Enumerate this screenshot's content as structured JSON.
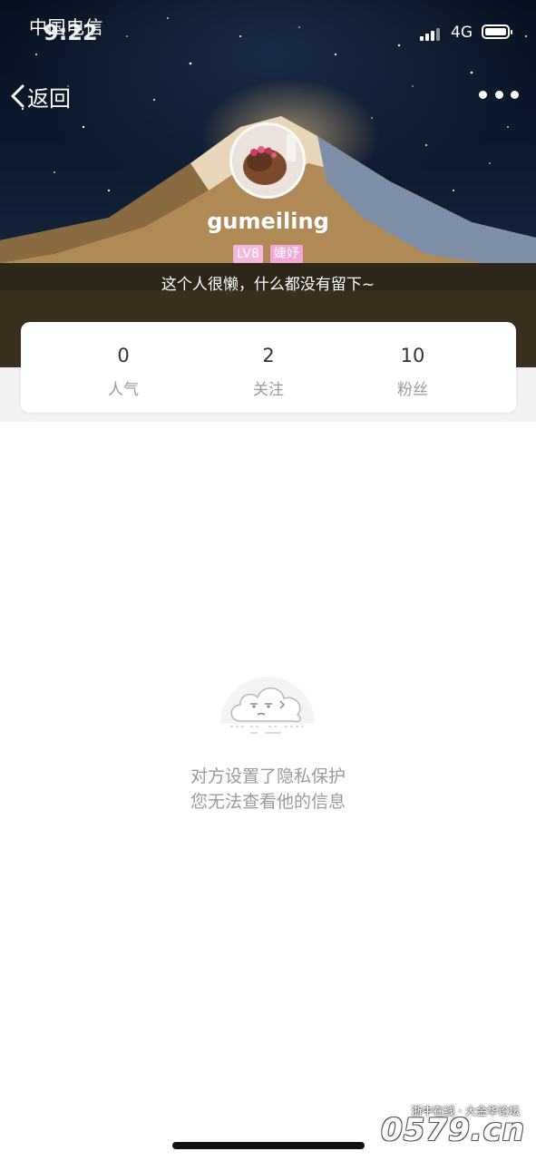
{
  "status_bar": {
    "carrier": "中国电信",
    "time": "9:22",
    "network": "4G"
  },
  "nav": {
    "back_label": "返回",
    "more_icon": "more-dots-icon"
  },
  "profile": {
    "username": "gumeiling",
    "level_badge": "LV8",
    "name_badge": "婕妤",
    "bio": "这个人很懒，什么都没有留下~"
  },
  "stats": [
    {
      "value": "0",
      "label": "人气"
    },
    {
      "value": "2",
      "label": "关注"
    },
    {
      "value": "10",
      "label": "粉丝"
    }
  ],
  "privacy": {
    "line1": "对方设置了隐私保护",
    "line2": "您无法查看他的信息"
  },
  "watermark": {
    "top_text": "浙中在线 · 大金华论坛",
    "main_text": "0579.cn"
  },
  "colors": {
    "badge_pink": "#f4a6d5",
    "muted_text": "#9a9a9a",
    "band_grey": "#f2f2f2"
  }
}
